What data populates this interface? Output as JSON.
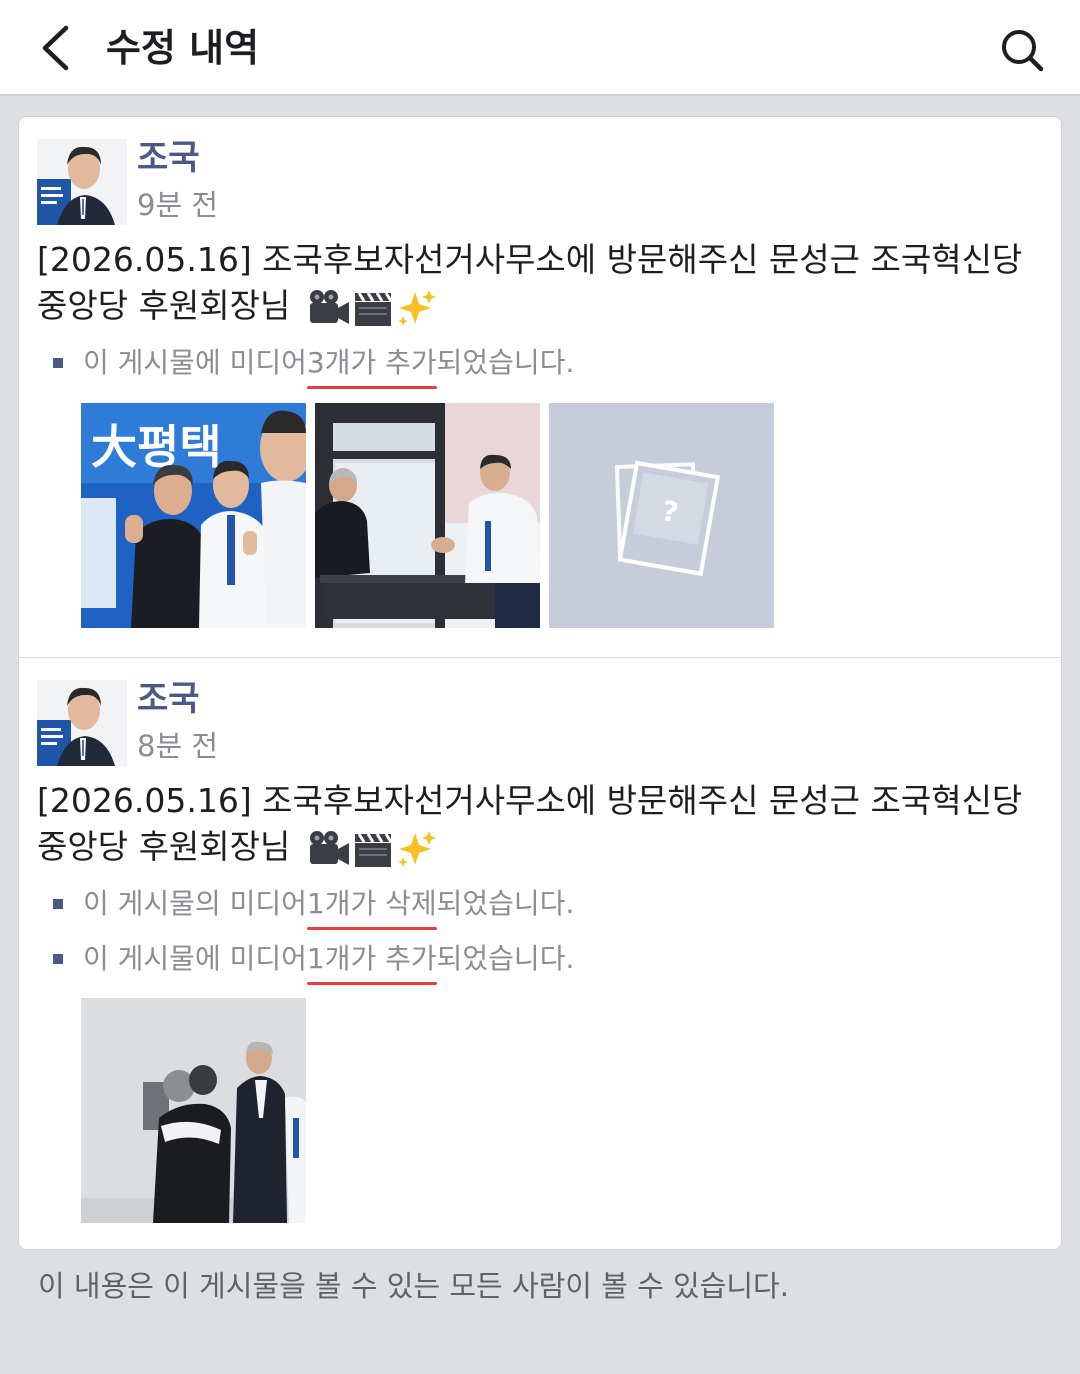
{
  "header": {
    "title": "수정 내역",
    "back_icon": "chevron-left-icon",
    "search_icon": "search-icon"
  },
  "entries": [
    {
      "author": "조국",
      "time": "9분 전",
      "text": "[2026.05.16] 조국후보자선거사무소에 방문해주신 문성근 조국혁신당 중앙당 후원회장님",
      "emojis": [
        "video-camera-icon",
        "clapper-board-icon",
        "sparkles-icon"
      ],
      "changes": [
        {
          "prefix": "이 게시물에 미디어 ",
          "highlight": "3개가 추가",
          "suffix": "되었습니다."
        }
      ],
      "media": [
        "photo-two-men-poster",
        "photo-meeting-table",
        "missing-media-placeholder"
      ]
    },
    {
      "author": "조국",
      "time": "8분 전",
      "text": "[2026.05.16] 조국후보자선거사무소에 방문해주신 문성근 조국혁신당 중앙당 후원회장님",
      "emojis": [
        "video-camera-icon",
        "clapper-board-icon",
        "sparkles-icon"
      ],
      "changes": [
        {
          "prefix": "이 게시물의 미디어 ",
          "highlight": "1개가 삭제",
          "suffix": "되었습니다."
        },
        {
          "prefix": "이 게시물에 미디어 ",
          "highlight": "1개가 추가",
          "suffix": "되었습니다."
        }
      ],
      "media": [
        "photo-hug"
      ]
    }
  ],
  "footer": {
    "note": "이 내용은 이 게시물을 볼 수 있는 모든 사람이 볼 수 있습니다."
  },
  "colors": {
    "author": "#4a5a85",
    "bullet": "#4a5a85",
    "underline": "#e3403d",
    "placeholder_bg": "#c7ccdb",
    "page_bg": "#dddfe3"
  }
}
